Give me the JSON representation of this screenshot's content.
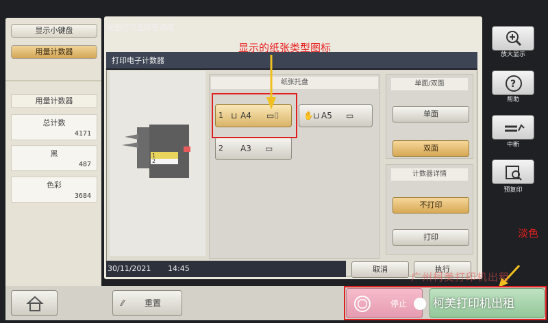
{
  "left": {
    "keyboard_label": "显示小键盘",
    "counter_label": "用量计数器",
    "header_label": "用量计数器",
    "counts": [
      {
        "label": "总计数",
        "value": "4171"
      },
      {
        "label": "黑",
        "value": "487"
      },
      {
        "label": "色彩",
        "value": "3684"
      }
    ]
  },
  "top": {
    "message": "双面打印选择普通纸."
  },
  "dialog": {
    "title": "打印电子计数器"
  },
  "tray": {
    "header": "纸张托盘",
    "items": [
      {
        "num": "1",
        "size": "A4",
        "selected": true
      },
      {
        "num": "",
        "size": "A5",
        "selected": false
      },
      {
        "num": "2",
        "size": "A3",
        "selected": false
      }
    ]
  },
  "duplex": {
    "header": "单面/双面",
    "options": [
      "单面",
      "双面"
    ],
    "active": "双面"
  },
  "detail": {
    "header": "计数器详情",
    "options": [
      "不打印",
      "打印"
    ],
    "active": "不打印"
  },
  "status": {
    "date": "30/11/2021",
    "time": "14:45"
  },
  "actions": {
    "cancel": "取消",
    "execute": "执行"
  },
  "sidebar": {
    "zoom": "放大显示",
    "help": "帮助",
    "interrupt": "中断",
    "preview": "预复印"
  },
  "bottom": {
    "reset": "重置",
    "stop": "停止"
  },
  "annotations": {
    "paper_icon_note": "显示的纸张类型图标",
    "pale_note": "淡色",
    "watermark": "广州柯美打印机出租",
    "brand": "柯美打印机出租"
  },
  "colors": {
    "annotation": "#e82020",
    "selected": "#d9b468",
    "stop": "#e69bb0",
    "start": "#93c699"
  }
}
